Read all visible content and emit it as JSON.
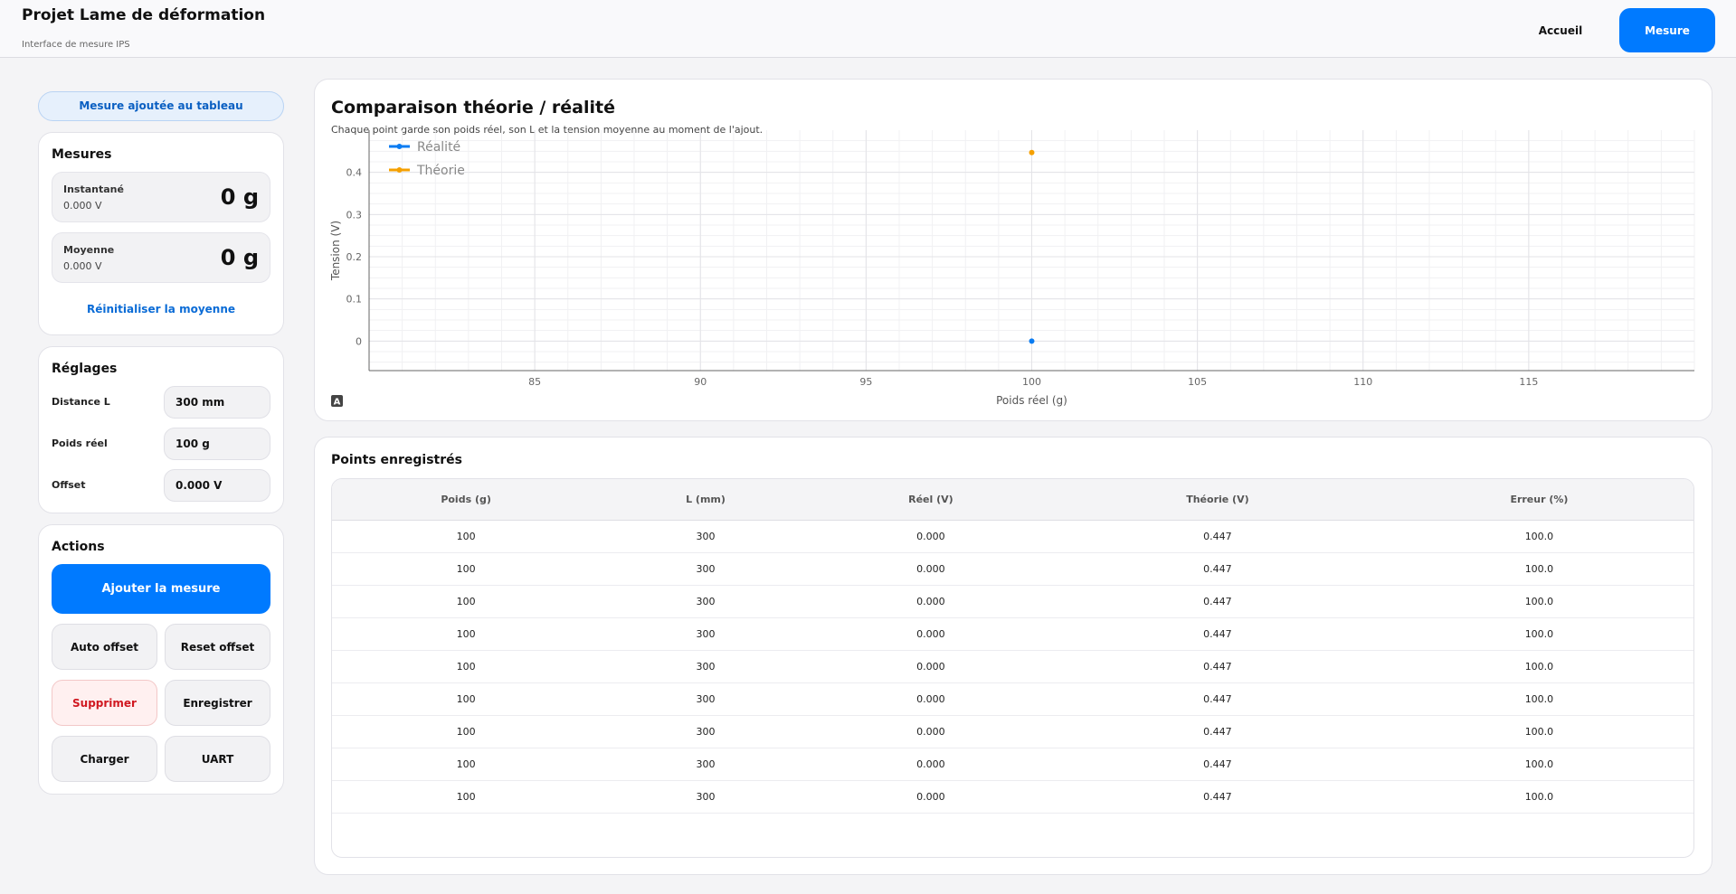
{
  "header": {
    "title": "Projet Lame de déformation",
    "subtitle": "Interface de mesure IPS",
    "nav": {
      "home": "Accueil",
      "measure": "Mesure"
    }
  },
  "toast": "Mesure ajoutée au tableau",
  "mesures": {
    "title": "Mesures",
    "instant": {
      "label": "Instantané",
      "voltage": "0.000 V",
      "value": "0 g"
    },
    "average": {
      "label": "Moyenne",
      "voltage": "0.000 V",
      "value": "0 g"
    },
    "reset_label": "Réinitialiser la moyenne"
  },
  "reglages": {
    "title": "Réglages",
    "distance": {
      "label": "Distance L",
      "value": "300 mm"
    },
    "poids": {
      "label": "Poids réel",
      "value": "100 g"
    },
    "offset": {
      "label": "Offset",
      "value": "0.000 V"
    }
  },
  "actions": {
    "title": "Actions",
    "add": "Ajouter la mesure",
    "auto_offset": "Auto offset",
    "reset_offset": "Reset offset",
    "delete": "Supprimer",
    "save": "Enregistrer",
    "load": "Charger",
    "uart": "UART"
  },
  "chart": {
    "title": "Comparaison théorie / réalité",
    "subtitle": "Chaque point garde son poids réel, son L et la tension moyenne au moment de l'ajout.",
    "corner_icon": "A"
  },
  "chart_data": {
    "type": "scatter",
    "title": "",
    "xlabel": "Poids réel (g)",
    "ylabel": "Tension (V)",
    "xlim": [
      80,
      120
    ],
    "ylim": [
      -0.07,
      0.5
    ],
    "xticks": [
      85,
      90,
      95,
      100,
      105,
      110,
      115
    ],
    "yticks": [
      0,
      0.1,
      0.2,
      0.3,
      0.4
    ],
    "ytick_labels": [
      "0",
      "0.1",
      "0.2",
      "0.3",
      "0.4"
    ],
    "grid": true,
    "legend_position": "top-left",
    "series": [
      {
        "name": "Réalité",
        "color": "#0a7cf2",
        "points": [
          {
            "x": 100,
            "y": 0
          }
        ]
      },
      {
        "name": "Théorie",
        "color": "#f5a000",
        "points": [
          {
            "x": 100,
            "y": 0.447
          }
        ]
      }
    ]
  },
  "table": {
    "title": "Points enregistrés",
    "columns": [
      "Poids (g)",
      "L (mm)",
      "Réel (V)",
      "Théorie (V)",
      "Erreur (%)"
    ],
    "rows": [
      [
        "100",
        "300",
        "0.000",
        "0.447",
        "100.0"
      ],
      [
        "100",
        "300",
        "0.000",
        "0.447",
        "100.0"
      ],
      [
        "100",
        "300",
        "0.000",
        "0.447",
        "100.0"
      ],
      [
        "100",
        "300",
        "0.000",
        "0.447",
        "100.0"
      ],
      [
        "100",
        "300",
        "0.000",
        "0.447",
        "100.0"
      ],
      [
        "100",
        "300",
        "0.000",
        "0.447",
        "100.0"
      ],
      [
        "100",
        "300",
        "0.000",
        "0.447",
        "100.0"
      ],
      [
        "100",
        "300",
        "0.000",
        "0.447",
        "100.0"
      ],
      [
        "100",
        "300",
        "0.000",
        "0.447",
        "100.0"
      ]
    ]
  }
}
